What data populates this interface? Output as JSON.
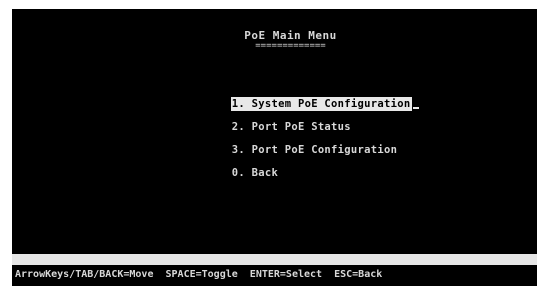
{
  "screen": {
    "title": "PoE Main Menu",
    "title_underline": "=============",
    "menu_items": [
      {
        "label": "1. System PoE Configuration",
        "selected": true
      },
      {
        "label": "2. Port PoE Status",
        "selected": false
      },
      {
        "label": "3. Port PoE Configuration",
        "selected": false
      },
      {
        "label": "0. Back",
        "selected": false
      }
    ],
    "help_text": "ArrowKeys/TAB/BACK=Move  SPACE=Toggle  ENTER=Select  ESC=Back"
  },
  "colors": {
    "background": "#000000",
    "text": "#d8d8d8",
    "highlight": "#e8e8e8",
    "frame": "#ffffff"
  }
}
